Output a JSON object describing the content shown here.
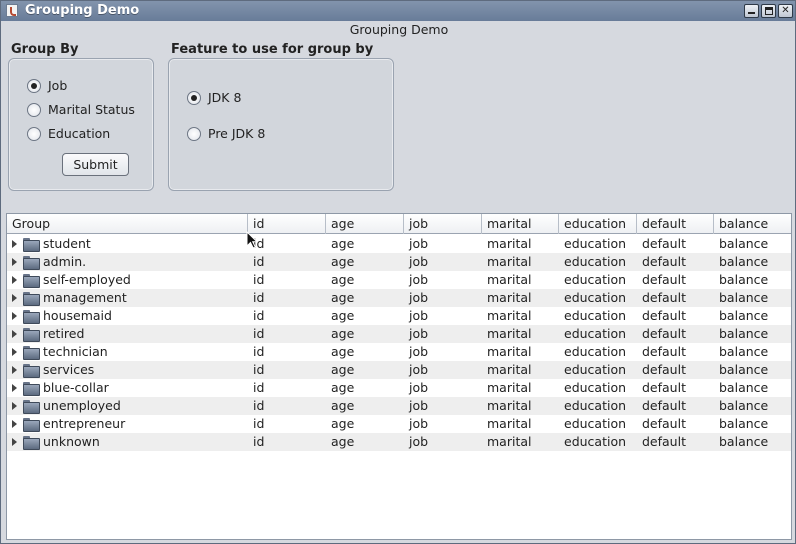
{
  "window": {
    "title": "Grouping Demo",
    "frame_title": "Grouping Demo"
  },
  "group_by": {
    "label": "Group By",
    "options": [
      "Job",
      "Marital Status",
      "Education"
    ],
    "selected": "Job",
    "submit_label": "Submit"
  },
  "feature": {
    "label": "Feature to use for group by",
    "options": [
      "JDK 8",
      "Pre JDK 8"
    ],
    "selected": "JDK 8"
  },
  "table": {
    "columns": [
      "Group",
      "id",
      "age",
      "job",
      "marital",
      "education",
      "default",
      "balance"
    ],
    "rows": [
      [
        "student",
        "id",
        "age",
        "job",
        "marital",
        "education",
        "default",
        "balance"
      ],
      [
        "admin.",
        "id",
        "age",
        "job",
        "marital",
        "education",
        "default",
        "balance"
      ],
      [
        "self-employed",
        "id",
        "age",
        "job",
        "marital",
        "education",
        "default",
        "balance"
      ],
      [
        "management",
        "id",
        "age",
        "job",
        "marital",
        "education",
        "default",
        "balance"
      ],
      [
        "housemaid",
        "id",
        "age",
        "job",
        "marital",
        "education",
        "default",
        "balance"
      ],
      [
        "retired",
        "id",
        "age",
        "job",
        "marital",
        "education",
        "default",
        "balance"
      ],
      [
        "technician",
        "id",
        "age",
        "job",
        "marital",
        "education",
        "default",
        "balance"
      ],
      [
        "services",
        "id",
        "age",
        "job",
        "marital",
        "education",
        "default",
        "balance"
      ],
      [
        "blue-collar",
        "id",
        "age",
        "job",
        "marital",
        "education",
        "default",
        "balance"
      ],
      [
        "unemployed",
        "id",
        "age",
        "job",
        "marital",
        "education",
        "default",
        "balance"
      ],
      [
        "entrepreneur",
        "id",
        "age",
        "job",
        "marital",
        "education",
        "default",
        "balance"
      ],
      [
        "unknown",
        "id",
        "age",
        "job",
        "marital",
        "education",
        "default",
        "balance"
      ]
    ]
  },
  "icons": {
    "app": "java-app-icon",
    "minimize": "minimize-icon",
    "maximize": "maximize-icon",
    "close": "close-icon",
    "row_expander": "triangle-right-icon",
    "row_folder": "folder-icon",
    "cursor": "mouse-pointer-icon"
  },
  "colors": {
    "titlebar": "#6f83a0",
    "window_bg": "#d6d9df",
    "alt_row": "#eeeeee"
  }
}
